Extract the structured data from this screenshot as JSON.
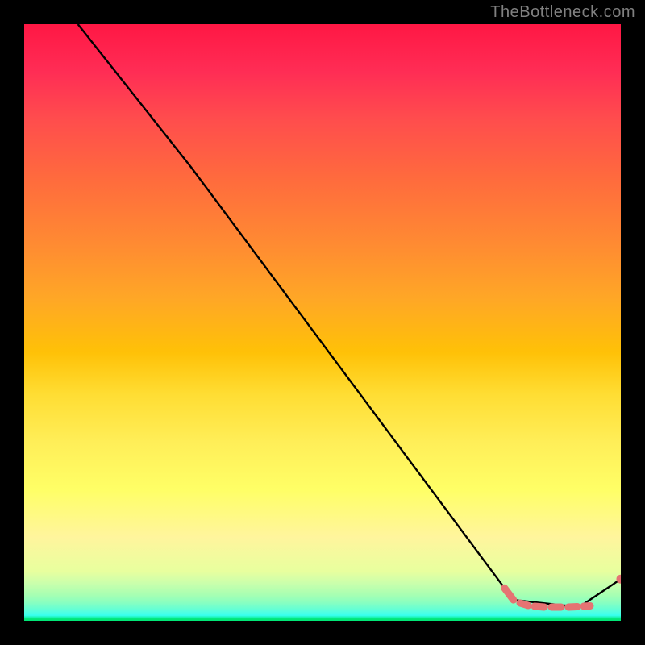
{
  "attribution": "TheBottleneck.com",
  "chart_data": {
    "type": "line",
    "title": "",
    "xlabel": "",
    "ylabel": "",
    "xlim": [
      0,
      100
    ],
    "ylim": [
      0,
      100
    ],
    "grid": false,
    "legend_position": "none",
    "gradient_colors": {
      "top": "#ff1744",
      "bottom": "#00e676"
    },
    "series": [
      {
        "name": "main-curve",
        "color": "#000000",
        "x": [
          9,
          28,
          80.5,
          82,
          93,
          100
        ],
        "y": [
          100,
          76,
          5.5,
          3.5,
          2.3,
          7
        ]
      },
      {
        "name": "dashed-segment",
        "color": "#e57373",
        "style": "dashed",
        "x": [
          80.5,
          82,
          84.2,
          86.5,
          88.5,
          90.5,
          92.5,
          94.5
        ],
        "y": [
          5.5,
          3.5,
          2.7,
          2.4,
          2.3,
          2.3,
          2.3,
          2.4
        ]
      },
      {
        "name": "end-dot",
        "color": "#e57373",
        "style": "point",
        "x": [
          100
        ],
        "y": [
          7
        ]
      }
    ]
  }
}
